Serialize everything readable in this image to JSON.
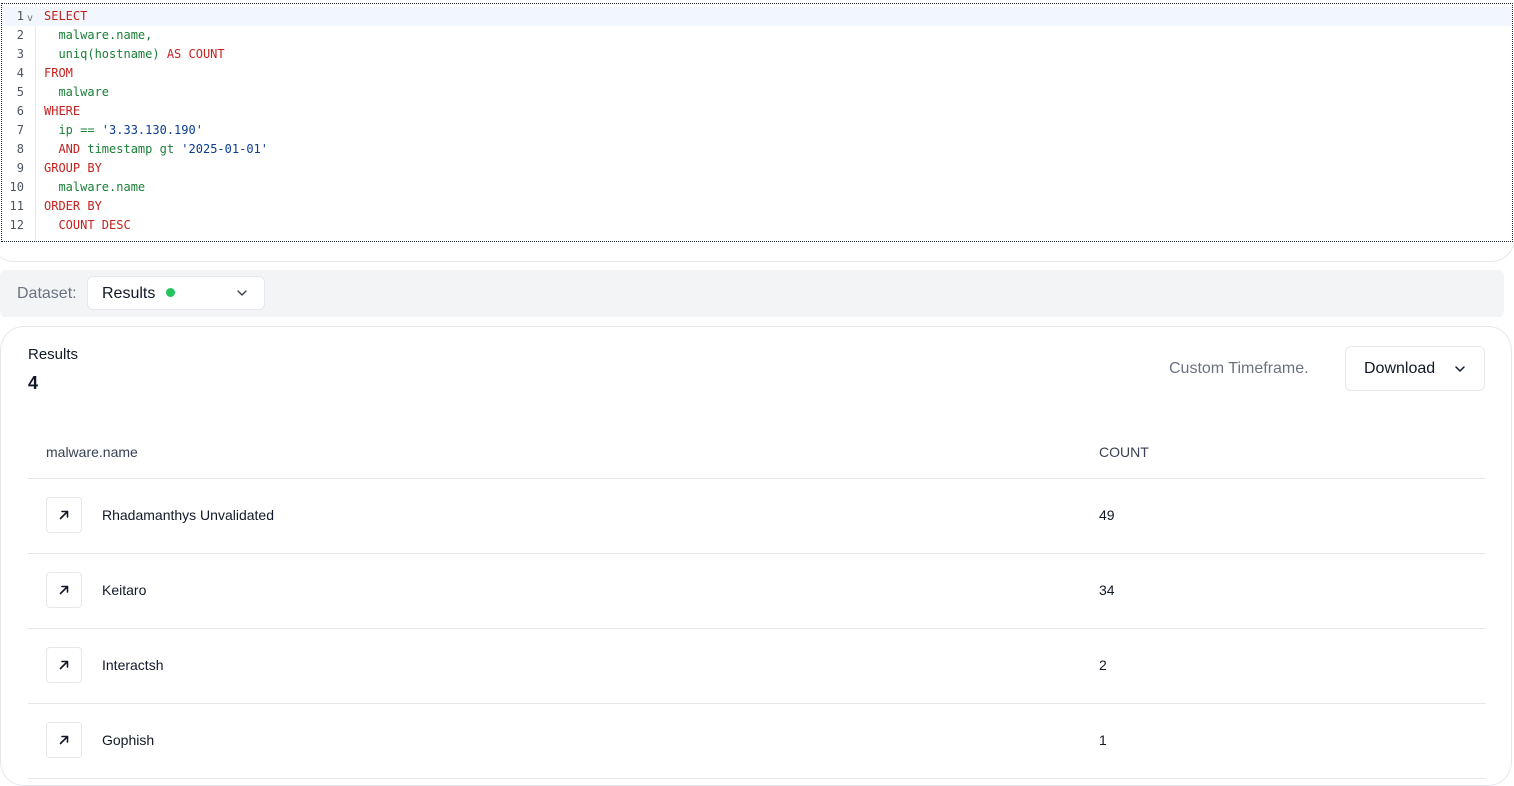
{
  "editor": {
    "lines": [
      {
        "n": "1",
        "tokens": [
          {
            "t": "SELECT",
            "c": "kw"
          }
        ],
        "active": true,
        "fold": true
      },
      {
        "n": "2",
        "tokens": [
          {
            "t": "  malware.name,",
            "c": "id"
          }
        ]
      },
      {
        "n": "3",
        "tokens": [
          {
            "t": "  uniq(hostname) ",
            "c": "fn"
          },
          {
            "t": "AS COUNT",
            "c": "kw"
          }
        ]
      },
      {
        "n": "4",
        "tokens": [
          {
            "t": "FROM",
            "c": "kw"
          }
        ]
      },
      {
        "n": "5",
        "tokens": [
          {
            "t": "  malware",
            "c": "id"
          }
        ]
      },
      {
        "n": "6",
        "tokens": [
          {
            "t": "WHERE",
            "c": "kw"
          }
        ]
      },
      {
        "n": "7",
        "tokens": [
          {
            "t": "  ip == ",
            "c": "id"
          },
          {
            "t": "'3.33.130.190'",
            "c": "str"
          }
        ]
      },
      {
        "n": "8",
        "tokens": [
          {
            "t": "  AND ",
            "c": "kw"
          },
          {
            "t": "timestamp ",
            "c": "id"
          },
          {
            "t": "gt ",
            "c": "op"
          },
          {
            "t": "'2025-01-01'",
            "c": "str"
          }
        ]
      },
      {
        "n": "9",
        "tokens": [
          {
            "t": "GROUP BY",
            "c": "kw"
          }
        ]
      },
      {
        "n": "10",
        "tokens": [
          {
            "t": "  malware.name",
            "c": "id"
          }
        ]
      },
      {
        "n": "11",
        "tokens": [
          {
            "t": "ORDER BY",
            "c": "kw"
          }
        ]
      },
      {
        "n": "12",
        "tokens": [
          {
            "t": "  COUNT DESC",
            "c": "kw"
          }
        ]
      }
    ],
    "fold_glyph": "v"
  },
  "dataset": {
    "label": "Dataset:",
    "selected": "Results",
    "status_color": "#22c55e"
  },
  "results": {
    "title": "Results",
    "count": "4",
    "timeframe": "Custom Timeframe.",
    "download_label": "Download",
    "columns": [
      "malware.name",
      "COUNT"
    ],
    "rows": [
      {
        "name": "Rhadamanthys Unvalidated",
        "count": "49"
      },
      {
        "name": "Keitaro",
        "count": "34"
      },
      {
        "name": "Interactsh",
        "count": "2"
      },
      {
        "name": "Gophish",
        "count": "1"
      }
    ]
  },
  "icons": {
    "fold": "chevron-down-icon",
    "dataset_chevron": "chevron-down-icon",
    "download_chevron": "chevron-down-icon",
    "row_open": "arrow-up-right-icon"
  }
}
